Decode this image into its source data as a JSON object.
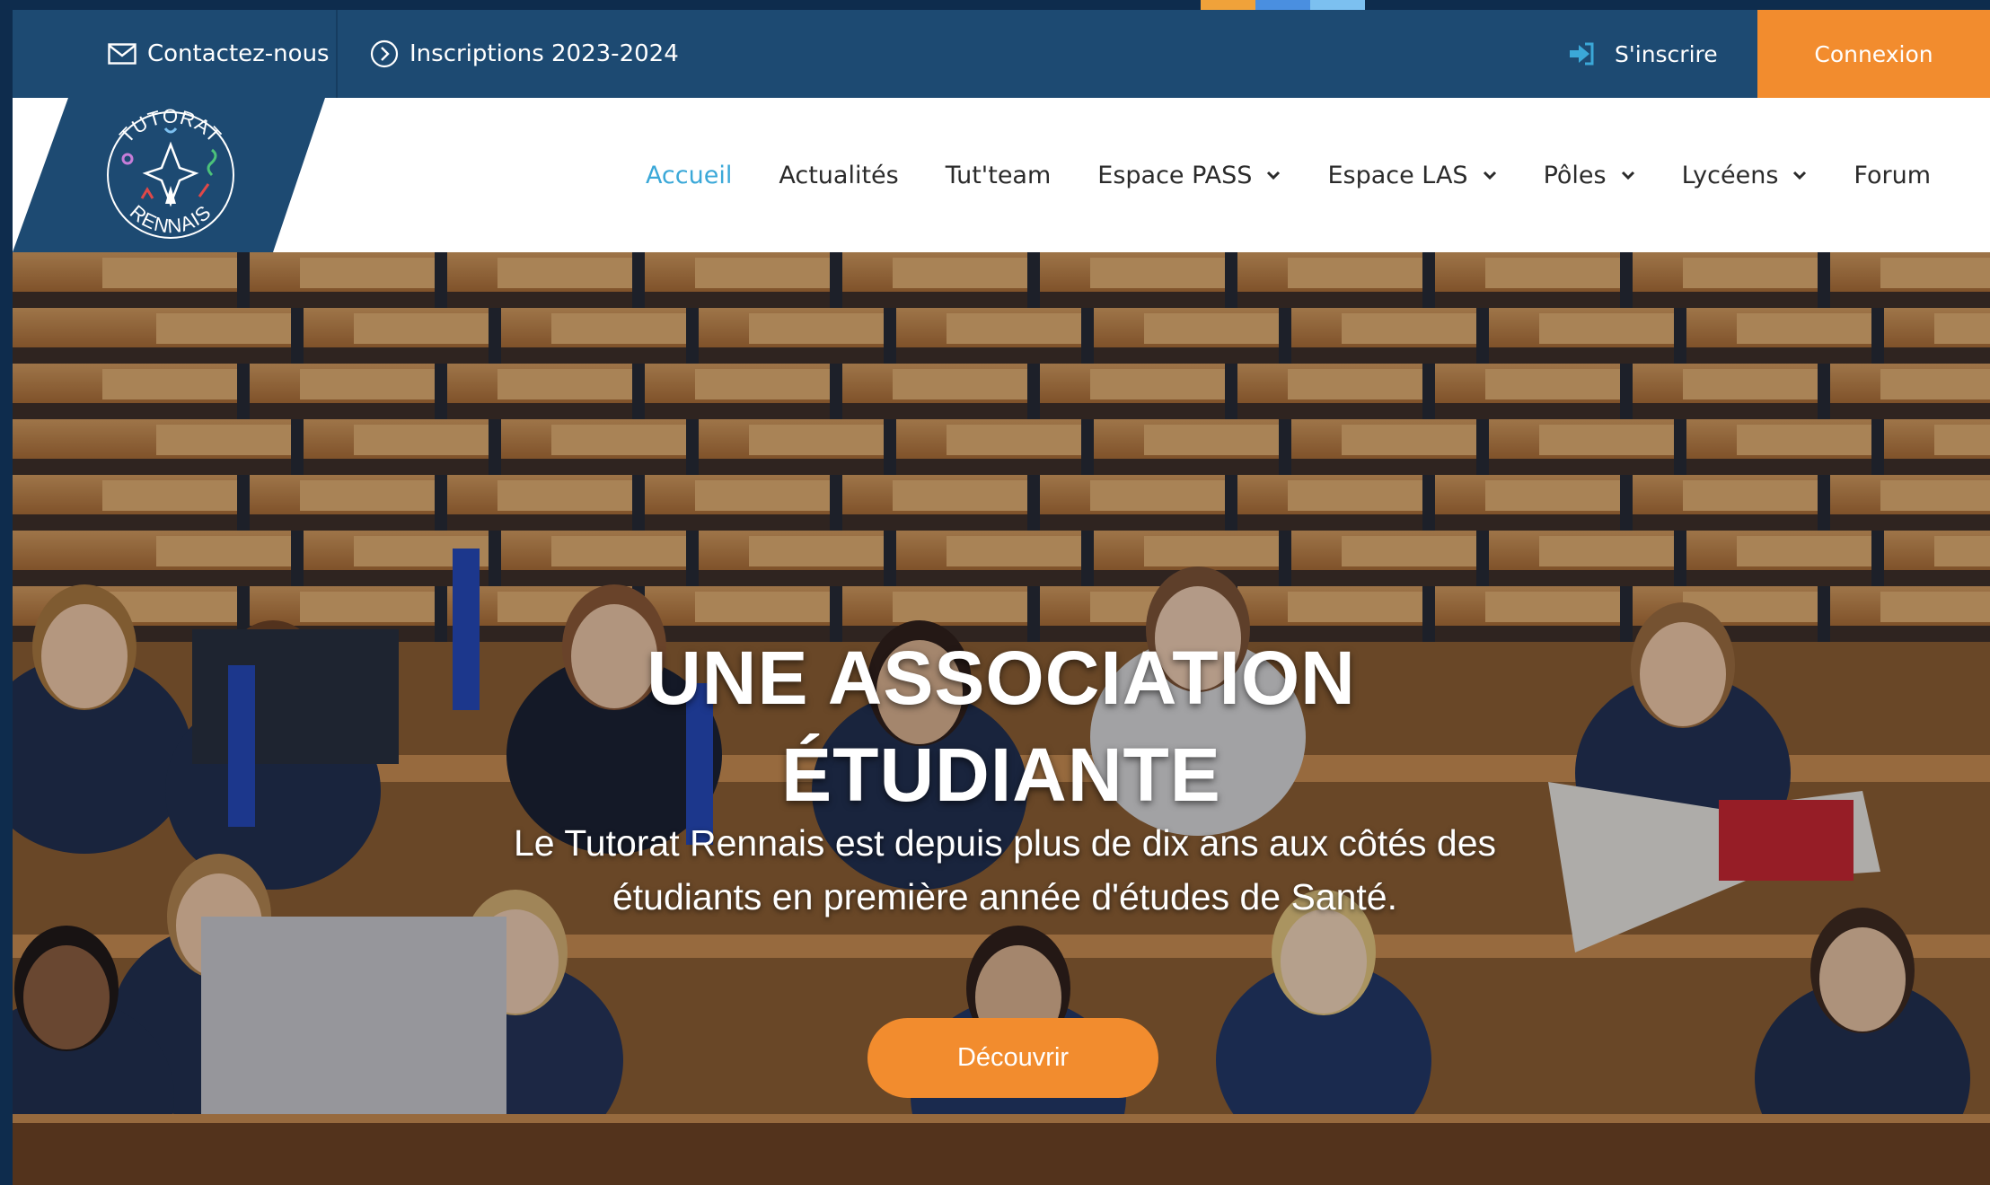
{
  "top_bar": {
    "contact_label": "Contactez-nous",
    "registrations_label": "Inscriptions 2023-2024",
    "signup_label": "S'inscrire",
    "login_label": "Connexion"
  },
  "logo": {
    "top_text": "TUTORAT",
    "bottom_text": "RENNAIS"
  },
  "nav": {
    "items": [
      {
        "label": "Accueil",
        "active": true,
        "dropdown": false
      },
      {
        "label": "Actualités",
        "active": false,
        "dropdown": false
      },
      {
        "label": "Tut'team",
        "active": false,
        "dropdown": false
      },
      {
        "label": "Espace PASS",
        "active": false,
        "dropdown": true
      },
      {
        "label": "Espace LAS",
        "active": false,
        "dropdown": true
      },
      {
        "label": "Pôles",
        "active": false,
        "dropdown": true
      },
      {
        "label": "Lycéens",
        "active": false,
        "dropdown": true
      },
      {
        "label": "Forum",
        "active": false,
        "dropdown": false
      }
    ]
  },
  "hero": {
    "title_line1": "UNE ASSOCIATION",
    "title_line2": "ÉTUDIANTE",
    "subtitle_line1": "Le Tutorat Rennais est depuis plus de dix ans aux côtés des",
    "subtitle_line2": "étudiants en première année d'études de Santé.",
    "cta_label": "Découvrir"
  },
  "colors": {
    "primary_blue": "#1d4a72",
    "accent_orange": "#f28c2e",
    "active_link": "#3ba8d8",
    "frame": "#0e2c4d",
    "strip": [
      "#f0a23a",
      "#4a8fe0",
      "#7cc0f0"
    ]
  }
}
